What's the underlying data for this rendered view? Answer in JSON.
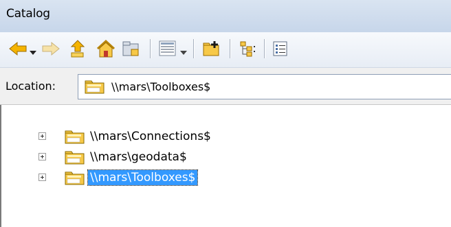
{
  "window": {
    "title": "Catalog"
  },
  "toolbar": {
    "buttons": [
      {
        "name": "back-button",
        "icon": "back-arrow-icon"
      },
      {
        "name": "back-dropdown-button",
        "icon": "dropdown-icon"
      },
      {
        "name": "forward-button",
        "icon": "forward-arrow-icon"
      },
      {
        "name": "up-level-button",
        "icon": "up-folder-icon"
      },
      {
        "name": "home-button",
        "icon": "home-icon"
      },
      {
        "name": "connect-folder-button",
        "icon": "connect-folder-icon"
      },
      {
        "name": "view-button",
        "icon": "list-view-icon"
      },
      {
        "name": "view-dropdown-button",
        "icon": "dropdown-icon"
      },
      {
        "name": "new-folder-button",
        "icon": "new-folder-icon"
      },
      {
        "name": "toggle-tree-button",
        "icon": "tree-icon"
      },
      {
        "name": "options-button",
        "icon": "options-icon"
      }
    ]
  },
  "location": {
    "label": "Location:",
    "value": "\\\\mars\\Toolboxes$"
  },
  "tree": {
    "items": [
      {
        "label": "\\\\mars\\Connections$",
        "selected": false
      },
      {
        "label": "\\\\mars\\geodata$",
        "selected": false
      },
      {
        "label": "\\\\mars\\Toolboxes$",
        "selected": true
      }
    ]
  },
  "colors": {
    "selection": "#3399ff",
    "folder": "#f5c842",
    "arrow": "#f0a500"
  }
}
